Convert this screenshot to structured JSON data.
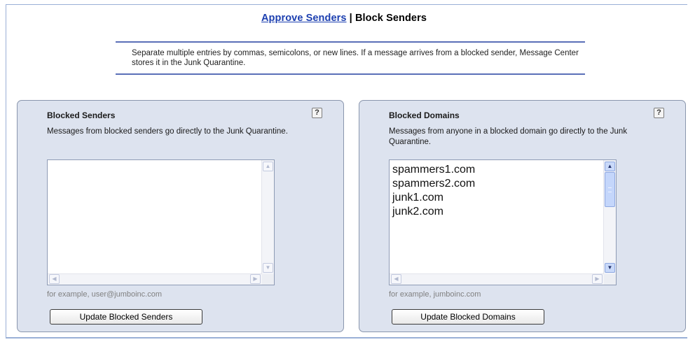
{
  "header": {
    "approve_link": "Approve Senders",
    "separator": " | ",
    "block_label": "Block Senders"
  },
  "info_text": "Separate multiple entries by commas, semicolons, or new lines. If a message arrives from a blocked sender, Message Center stores it in the Junk Quarantine.",
  "help_icon_glyph": "?",
  "panels": {
    "senders": {
      "title": "Blocked Senders",
      "description": "Messages from blocked senders go directly to the Junk Quarantine.",
      "textarea_value": "",
      "example": "for example, user@jumboinc.com",
      "button": "Update Blocked Senders"
    },
    "domains": {
      "title": "Blocked Domains",
      "description": "Messages from anyone in a blocked domain go directly to the Junk Quarantine.",
      "textarea_value": "spammers1.com\nspammers2.com\njunk1.com\njunk2.com",
      "example": "for example, jumboinc.com",
      "button": "Update Blocked Domains"
    }
  },
  "icons": {
    "help": "help-icon",
    "scroll_up": "scroll-up-arrow",
    "scroll_down": "scroll-down-arrow",
    "scroll_left": "scroll-left-arrow",
    "scroll_right": "scroll-right-arrow"
  },
  "colors": {
    "link": "#1c3fb0",
    "panel_bg": "#dde3ef",
    "rule": "#5a6fb8",
    "example_text": "#808080"
  }
}
